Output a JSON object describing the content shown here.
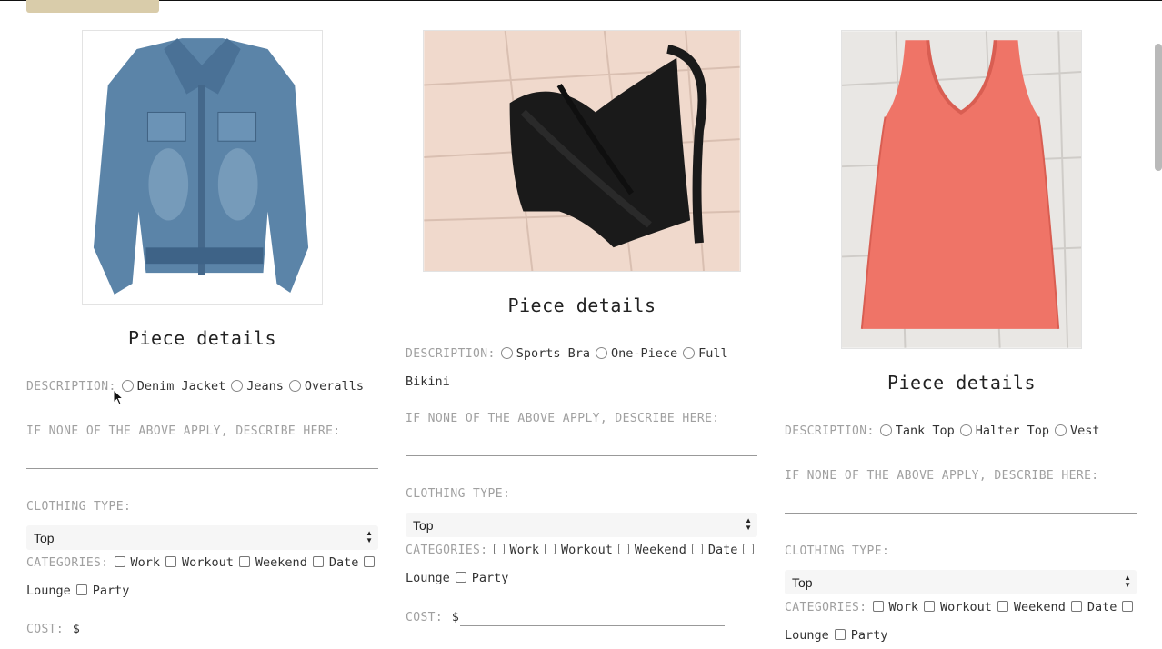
{
  "cards": [
    {
      "title": "Piece details",
      "description_label": "DESCRIPTION:",
      "options": [
        "Denim Jacket",
        "Jeans",
        "Overalls"
      ],
      "describe_label": "IF NONE OF THE ABOVE APPLY, DESCRIBE HERE:",
      "clothing_type_label": "CLOTHING TYPE:",
      "clothing_type_value": "Top",
      "categories_label": "CATEGORIES:",
      "categories": [
        "Work",
        "Workout",
        "Weekend",
        "Date",
        "Lounge",
        "Party"
      ],
      "cost_label": "COST:",
      "cost_symbol": "$"
    },
    {
      "title": "Piece details",
      "description_label": "DESCRIPTION:",
      "options": [
        "Sports Bra",
        "One-Piece",
        "Full Bikini"
      ],
      "describe_label": "IF NONE OF THE ABOVE APPLY, DESCRIBE HERE:",
      "clothing_type_label": "CLOTHING TYPE:",
      "clothing_type_value": "Top",
      "categories_label": "CATEGORIES:",
      "categories": [
        "Work",
        "Workout",
        "Weekend",
        "Date",
        "Lounge",
        "Party"
      ],
      "cost_label": "COST:",
      "cost_symbol": "$"
    },
    {
      "title": "Piece details",
      "description_label": "DESCRIPTION:",
      "options": [
        "Tank Top",
        "Halter Top",
        "Vest"
      ],
      "describe_label": "IF NONE OF THE ABOVE APPLY, DESCRIBE HERE:",
      "clothing_type_label": "CLOTHING TYPE:",
      "clothing_type_value": "Top",
      "categories_label": "CATEGORIES:",
      "categories": [
        "Work",
        "Workout",
        "Weekend",
        "Date",
        "Lounge",
        "Party"
      ]
    }
  ],
  "icons": {
    "select_arrows": "up-down-arrows-icon",
    "cursor": "mouse-pointer-icon"
  },
  "colors": {
    "accent_button": "#d9ccaa",
    "label_gray": "#a0a0a0",
    "tank_top": "#ef7467"
  }
}
